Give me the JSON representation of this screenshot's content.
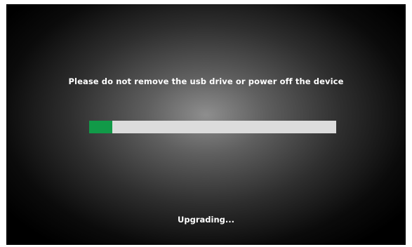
{
  "upgrade": {
    "warning_text": "Please do not remove the usb drive or power off the device",
    "status_text": "Upgrading...",
    "progress_fraction": 0.095
  },
  "colors": {
    "progress_fill": "#119a48",
    "progress_track": "#dcdcdc",
    "text": "#ffffff",
    "background_center": "#8e8e8e",
    "background_edge": "#000000"
  }
}
